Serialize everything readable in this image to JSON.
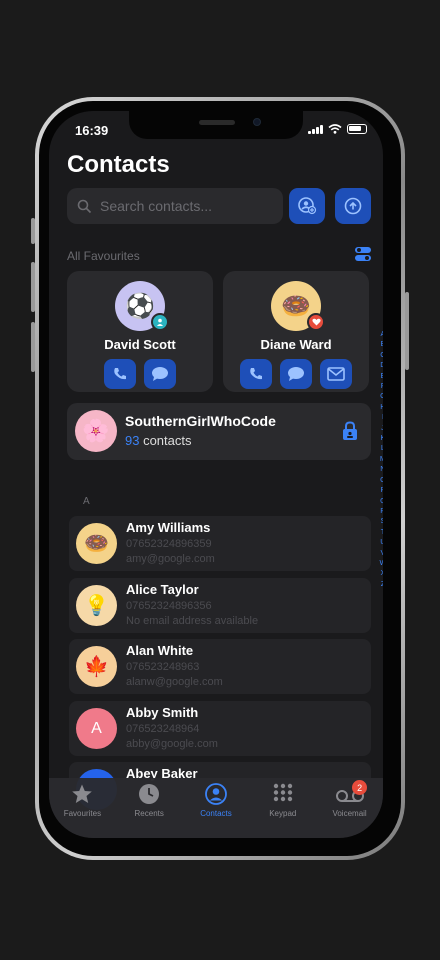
{
  "status_bar": {
    "time": "16:39"
  },
  "header": {
    "title": "Contacts"
  },
  "search": {
    "placeholder": "Search contacts..."
  },
  "favourites": {
    "label": "All Favourites",
    "items": [
      {
        "name": "David Scott",
        "avatar": "⚽",
        "badge": "contact-icon"
      },
      {
        "name": "Diane Ward",
        "avatar": "🍩",
        "badge": "heart-icon"
      }
    ]
  },
  "group": {
    "name": "SouthernGirlWhoCode",
    "count": "93",
    "count_suffix": " contacts",
    "avatar": "🌸"
  },
  "section_letter": "A",
  "contacts": [
    {
      "name": "Amy Williams",
      "phone": "07652324896359",
      "email": "amy@google.com",
      "avatar": "🍩"
    },
    {
      "name": "Alice Taylor",
      "phone": "07652324896356",
      "email": "No email address available",
      "avatar": "💡"
    },
    {
      "name": "Alan White",
      "phone": "07652324896­3",
      "email": "alanw@google.com",
      "avatar": "🍁"
    },
    {
      "name": "Abby Smith",
      "phone": "07652324896­4",
      "email": "abby@google.com",
      "avatar": "A"
    },
    {
      "name": "Abey Baker",
      "phone": "",
      "email": "",
      "avatar": ""
    }
  ],
  "index_letters": [
    "A",
    "B",
    "C",
    "D",
    "E",
    "F",
    "G",
    "H",
    "I",
    "J",
    "K",
    "L",
    "M",
    "N",
    "O",
    "P",
    "Q",
    "R",
    "S",
    "T",
    "U",
    "V",
    "W",
    "X",
    "Z"
  ],
  "tabs": [
    {
      "label": "Favourites",
      "icon": "star-icon"
    },
    {
      "label": "Recents",
      "icon": "clock-icon"
    },
    {
      "label": "Contacts",
      "icon": "person-circle-icon"
    },
    {
      "label": "Keypad",
      "icon": "keypad-icon"
    },
    {
      "label": "Voicemail",
      "icon": "voicemail-icon",
      "badge": "2"
    }
  ],
  "colors": {
    "accent": "#3b82f6",
    "button_bg": "#1e4fb8",
    "background": "#1a1a1c",
    "badge": "#e74c3c"
  }
}
